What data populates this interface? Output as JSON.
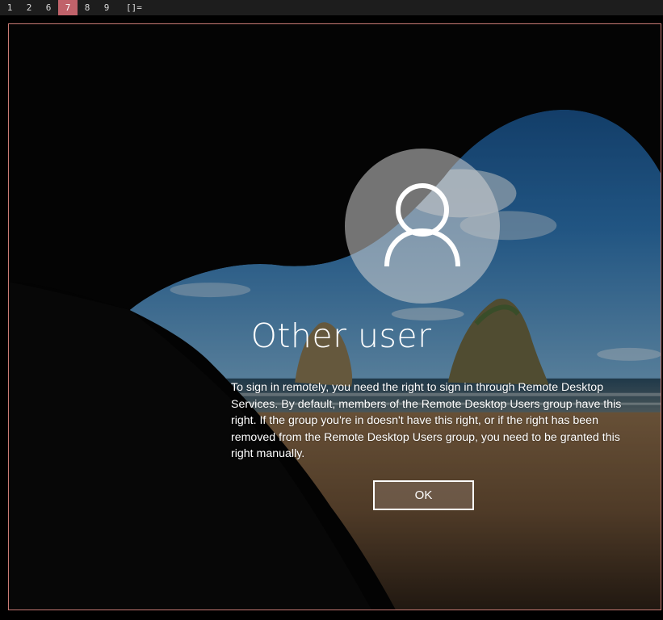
{
  "wm_bar": {
    "workspaces": [
      "1",
      "2",
      "6",
      "7",
      "8",
      "9"
    ],
    "active_workspace": "7",
    "layout_indicator": "[]="
  },
  "login": {
    "avatar_icon": "user-icon",
    "username": "Other user",
    "message": "To sign in remotely, you need the right to sign in through Remote Desktop Services. By default, members of the Remote Desktop Users group have this right. If the group you're in doesn't have this right, or if the right has been removed from the Remote Desktop Users group, you need to be granted this right manually.",
    "ok_label": "OK"
  },
  "colors": {
    "active_workspace": "#c0626a",
    "window_border": "#c87a74",
    "text": "#ffffff"
  }
}
